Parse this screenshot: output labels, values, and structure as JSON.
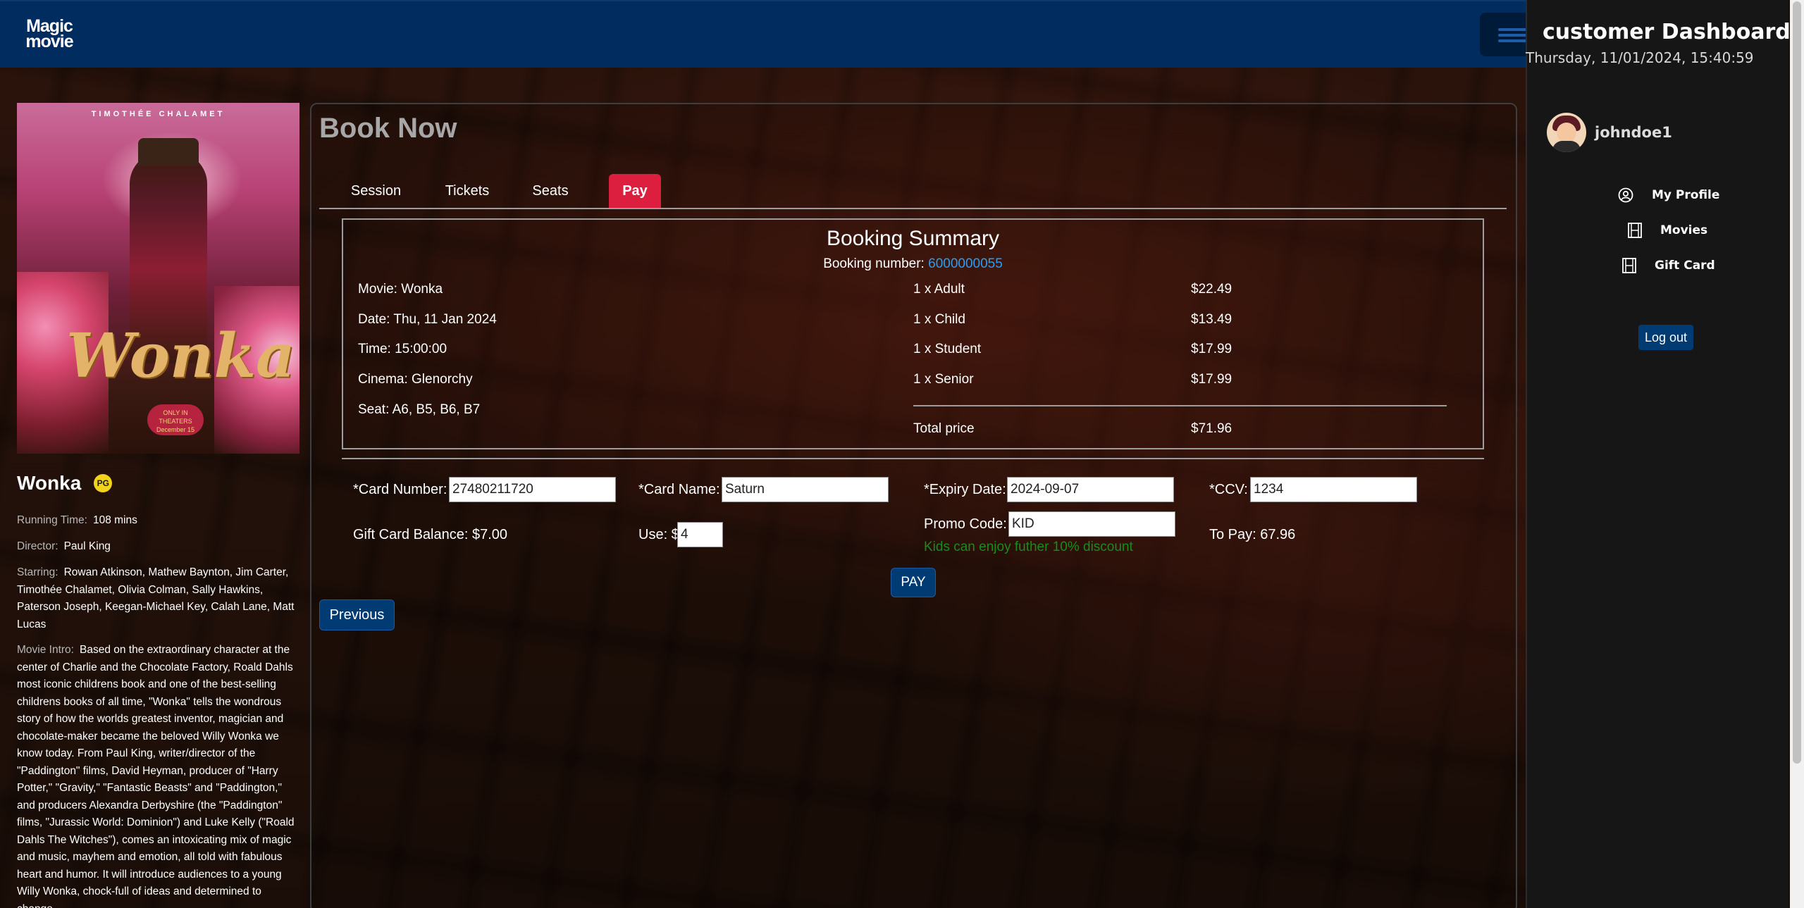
{
  "brand": {
    "logo_line1": "Magic",
    "logo_line2": "movie"
  },
  "movie": {
    "title": "Wonka",
    "rating": "PG",
    "poster": {
      "top_credit": "TIMOTHÉE CHALAMET",
      "title_art": "Wonka",
      "badge_line1": "ONLY IN THEATERS",
      "badge_line2": "December 15"
    },
    "running_time_label": "Running Time:",
    "running_time_value": "108  mins",
    "director_label": "Director:",
    "director_value": "Paul King",
    "starring_label": "Starring:",
    "starring_value": "Rowan Atkinson, Mathew Baynton, Jim Carter, Timothée Chalamet, Olivia Colman, Sally Hawkins, Paterson Joseph, Keegan-Michael Key, Calah Lane, Matt Lucas",
    "intro_label": "Movie Intro:",
    "intro_value": "Based on the extraordinary character at the center of Charlie and the Chocolate Factory, Roald Dahls most iconic childrens book and one of the best-selling childrens books of all time, \"Wonka\" tells the wondrous story of how the worlds greatest inventor, magician and chocolate-maker became the beloved Willy Wonka we know today. From Paul King, writer/director of the \"Paddington\" films, David Heyman, producer of \"Harry Potter,\" \"Gravity,\" \"Fantastic Beasts\" and \"Paddington,\" and producers Alexandra Derbyshire (the \"Paddington\" films, \"Jurassic World: Dominion\") and Luke Kelly (\"Roald Dahls The Witches\"), comes an intoxicating mix of magic and music, mayhem and emotion, all told with fabulous heart and humor. It will introduce audiences to a young Willy Wonka, chock-full of ideas and determined to change"
  },
  "booking": {
    "heading": "Book Now",
    "tabs": [
      {
        "label": "Session"
      },
      {
        "label": "Tickets"
      },
      {
        "label": "Seats"
      },
      {
        "label": "Pay",
        "active": true
      }
    ],
    "summary": {
      "title": "Booking Summary",
      "number_label": "Booking number:",
      "number_value": "6000000055",
      "movie": "Movie: Wonka",
      "date": "Date: Thu, 11 Jan 2024",
      "time": "Time: 15:00:00",
      "cinema": "Cinema: Glenorchy",
      "seat": "Seat: A6, B5, B6, B7",
      "tickets": [
        {
          "label": "1 x Adult",
          "price": "$22.49"
        },
        {
          "label": "1 x Child",
          "price": "$13.49"
        },
        {
          "label": "1 x Student",
          "price": "$17.99"
        },
        {
          "label": "1 x Senior",
          "price": "$17.99"
        }
      ],
      "total_label": "Total price",
      "total_value": "$71.96"
    },
    "payment": {
      "card_number_label": "*Card Number:",
      "card_number_value": "27480211720",
      "card_name_label": "*Card Name:",
      "card_name_value": "Saturn",
      "expiry_label": "*Expiry Date:",
      "expiry_value": "2024-09-07",
      "ccv_label": "*CCV:",
      "ccv_value": "1234",
      "gift_balance": "Gift Card Balance: $7.00",
      "use_label": "Use: $",
      "use_value": "4",
      "promo_label": "Promo Code:",
      "promo_value": "KID",
      "promo_message": "Kids can enjoy futher 10% discount",
      "to_pay": "To Pay: 67.96",
      "pay_button": "PAY",
      "previous_button": "Previous"
    }
  },
  "dashboard": {
    "title": "customer Dashboard",
    "datetime": "Thursday, 11/01/2024, 15:40:59",
    "username": "johndoe1",
    "menu": [
      {
        "label": "My Profile",
        "icon": "user-circle-icon"
      },
      {
        "label": "Movies",
        "icon": "film-icon"
      },
      {
        "label": "Gift Card",
        "icon": "film-icon"
      }
    ],
    "logout": "Log out"
  },
  "colors": {
    "nav": "#012c5f",
    "accent_tab": "#dc1f3f",
    "button": "#003b73",
    "link": "#2a9df4",
    "promo_ok": "#1d8a1d"
  }
}
